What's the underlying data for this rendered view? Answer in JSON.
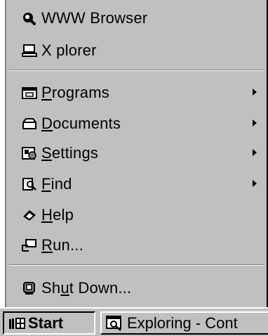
{
  "menu": {
    "items": [
      {
        "id": "www-browser",
        "label": "WWW Browser",
        "icon": "globe-search-icon",
        "submenu": false
      },
      {
        "id": "xplorer",
        "label": "X plorer",
        "icon": "computer-icon",
        "submenu": false
      },
      {
        "id": "programs",
        "pre": "",
        "ul": "P",
        "post": "rograms",
        "icon": "programs-folder-icon",
        "submenu": true
      },
      {
        "id": "documents",
        "pre": "",
        "ul": "D",
        "post": "ocuments",
        "icon": "documents-folder-icon",
        "submenu": true
      },
      {
        "id": "settings",
        "pre": "",
        "ul": "S",
        "post": "ettings",
        "icon": "settings-icon",
        "submenu": true
      },
      {
        "id": "find",
        "pre": "",
        "ul": "F",
        "post": "ind",
        "icon": "find-icon",
        "submenu": true
      },
      {
        "id": "help",
        "pre": "",
        "ul": "H",
        "post": "elp",
        "icon": "help-book-icon",
        "submenu": false
      },
      {
        "id": "run",
        "pre": "",
        "ul": "R",
        "post": "un...",
        "icon": "run-icon",
        "submenu": false
      },
      {
        "id": "shutdown",
        "pre": "Sh",
        "ul": "u",
        "post": "t Down...",
        "icon": "shutdown-icon",
        "submenu": false
      }
    ]
  },
  "taskbar": {
    "start_label": "Start",
    "task_label": "Exploring - Cont"
  }
}
